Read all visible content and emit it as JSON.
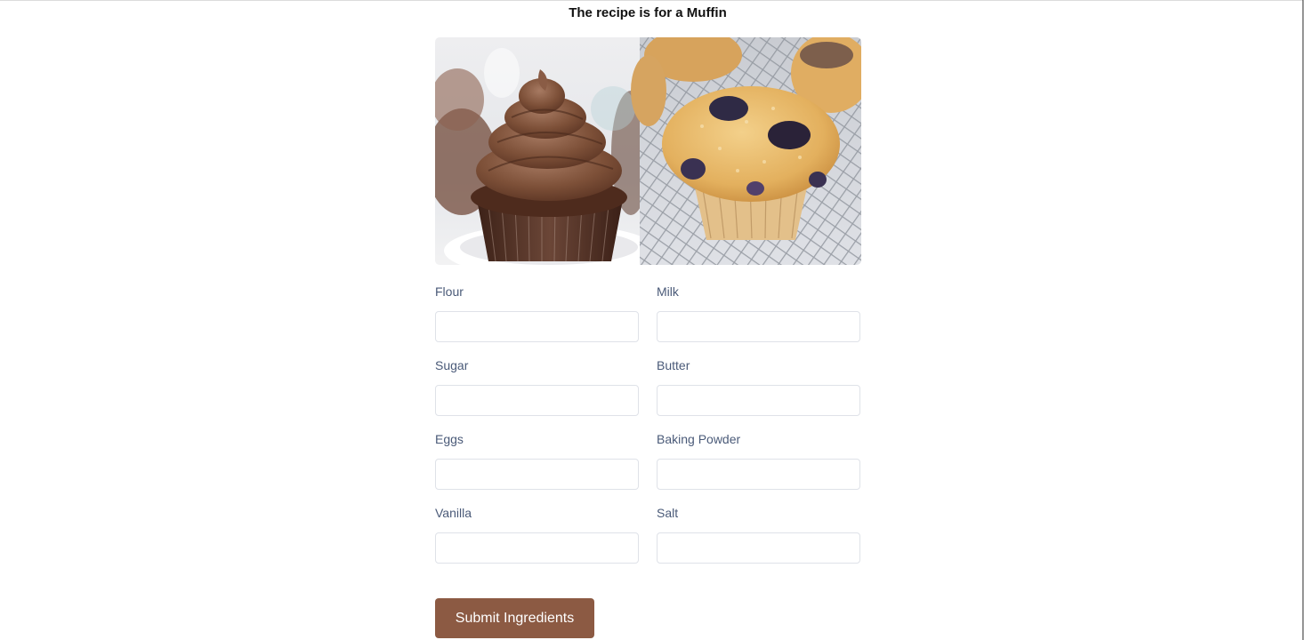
{
  "page": {
    "title": "The recipe is for a Muffin"
  },
  "images": {
    "left": "cupcake-image",
    "right": "muffin-image"
  },
  "form": {
    "fields": [
      {
        "label": "Flour",
        "value": "",
        "placeholder": ""
      },
      {
        "label": "Milk",
        "value": "",
        "placeholder": ""
      },
      {
        "label": "Sugar",
        "value": "",
        "placeholder": ""
      },
      {
        "label": "Butter",
        "value": "",
        "placeholder": ""
      },
      {
        "label": "Eggs",
        "value": "",
        "placeholder": ""
      },
      {
        "label": "Baking Powder",
        "value": "",
        "placeholder": ""
      },
      {
        "label": "Vanilla",
        "value": "",
        "placeholder": ""
      },
      {
        "label": "Salt",
        "value": "",
        "placeholder": ""
      }
    ],
    "submit_label": "Submit Ingredients"
  },
  "colors": {
    "button_bg": "#8c5a43",
    "label_text": "#4a5a78",
    "input_border": "#dfe2e8"
  }
}
